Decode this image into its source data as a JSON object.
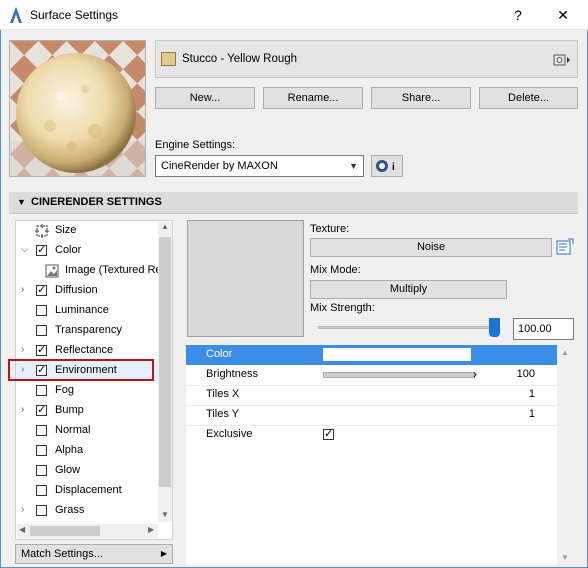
{
  "window": {
    "title": "Surface Settings",
    "help": "?",
    "close": "✕"
  },
  "material": {
    "name": "Stucco - Yellow Rough",
    "swatch_color": "#e3c98a"
  },
  "buttons": {
    "new": "New...",
    "rename": "Rename...",
    "share": "Share...",
    "delete": "Delete..."
  },
  "engine": {
    "label": "Engine Settings:",
    "value": "CineRender by MAXON",
    "info_icon": "i"
  },
  "section": {
    "title": "CINERENDER SETTINGS"
  },
  "channels": [
    {
      "label": "Size"
    },
    {
      "label": "Color"
    },
    {
      "label": "Image (Textured Re"
    },
    {
      "label": "Diffusion"
    },
    {
      "label": "Luminance"
    },
    {
      "label": "Transparency"
    },
    {
      "label": "Reflectance"
    },
    {
      "label": "Environment"
    },
    {
      "label": "Fog"
    },
    {
      "label": "Bump"
    },
    {
      "label": "Normal"
    },
    {
      "label": "Alpha"
    },
    {
      "label": "Glow"
    },
    {
      "label": "Displacement"
    },
    {
      "label": "Grass"
    }
  ],
  "match_settings": {
    "label": "Match Settings..."
  },
  "texture": {
    "label": "Texture:",
    "value": "Noise",
    "mix_mode_label": "Mix Mode:",
    "mix_mode_value": "Multiply",
    "mix_strength_label": "Mix Strength:",
    "mix_strength_value": "100.00",
    "mix_strength_fraction": 1.0
  },
  "properties": [
    {
      "name": "Color",
      "value": ""
    },
    {
      "name": "Brightness",
      "value": "100"
    },
    {
      "name": "Tiles X",
      "value": "1"
    },
    {
      "name": "Tiles Y",
      "value": "1"
    },
    {
      "name": "Exclusive",
      "value": ""
    }
  ]
}
